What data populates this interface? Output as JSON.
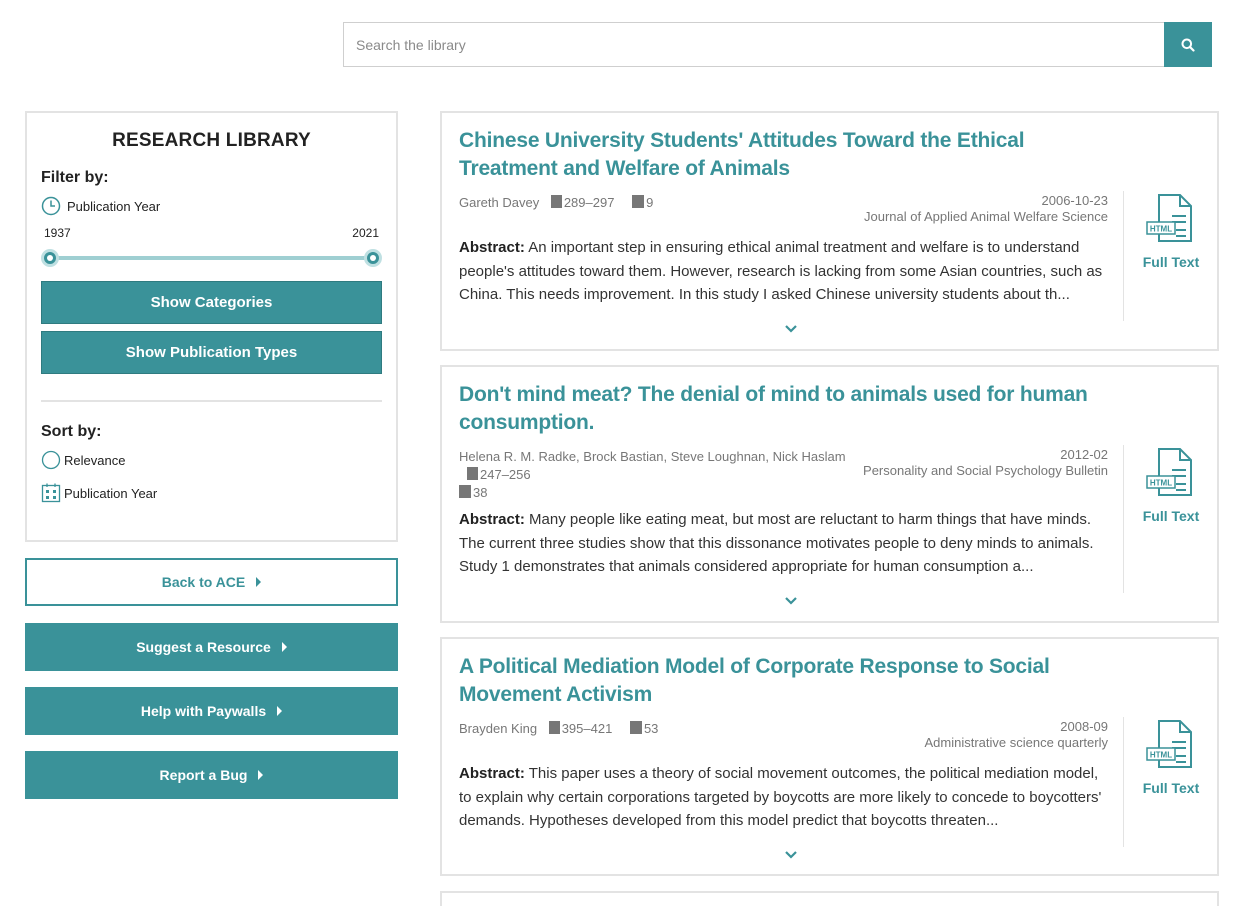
{
  "search": {
    "placeholder": "Search the library",
    "value": ""
  },
  "sidebar": {
    "title": "RESEARCH LIBRARY",
    "filter_label": "Filter by:",
    "filter_publication_year": "Publication Year",
    "year_min": "1937",
    "year_max": "2021",
    "range_low_fraction": 0.0,
    "range_high_fraction": 1.0,
    "show_categories": "Show Categories",
    "show_publication_types": "Show Publication Types",
    "sort_label": "Sort by:",
    "sort_relevance": "Relevance",
    "sort_publication_year": "Publication Year"
  },
  "actions": {
    "back": "Back to ACE",
    "suggest": "Suggest a Resource",
    "paywalls": "Help with Paywalls",
    "bug": "Report a Bug"
  },
  "results": [
    {
      "title": "Chinese University Students' Attitudes Toward the Ethical Treatment and Welfare of Animals",
      "authors": "Gareth Davey",
      "pages": "289–297",
      "volume": "9",
      "date": "2006-10-23",
      "journal": "Journal of Applied Animal Welfare Science",
      "abstract_label": "Abstract:",
      "abstract": "An important step in ensuring ethical animal treatment and welfare is to understand people's attitudes toward them. However, research is lacking from some Asian countries, such as China. This needs improvement. In this study I asked Chinese university students about th...",
      "fulltext_label": "Full Text",
      "badge": "HTML"
    },
    {
      "title": "Don't mind meat? The denial of mind to animals used for human consumption.",
      "authors": "Helena R. M. Radke, Brock Bastian, Steve Loughnan, Nick Haslam",
      "pages": "247–256",
      "volume": "38",
      "date": "2012-02",
      "journal": "Personality and Social Psychology Bulletin",
      "abstract_label": "Abstract:",
      "abstract": "Many people like eating meat, but most are reluctant to harm things that have minds. The current three studies show that this dissonance motivates people to deny minds to animals. Study 1 demonstrates that animals considered appropriate for human consumption a...",
      "fulltext_label": "Full Text",
      "badge": "HTML"
    },
    {
      "title": "A Political Mediation Model of Corporate Response to Social Movement Activism",
      "authors": "Brayden King",
      "pages": "395–421",
      "volume": "53",
      "date": "2008-09",
      "journal": "Administrative science quarterly",
      "abstract_label": "Abstract:",
      "abstract": "This paper uses a theory of social movement outcomes, the political mediation model, to explain why certain corporations targeted by boycotts are more likely to concede to boycotters' demands. Hypotheses developed from this model predict that boycotts threaten...",
      "fulltext_label": "Full Text",
      "badge": "HTML"
    }
  ],
  "colors": {
    "accent": "#3a9299",
    "border": "#e3e3e3",
    "muted": "#777777"
  },
  "icons": {
    "search": "search-icon",
    "filter_year": "clock-icon",
    "sort_relevance": "circle-icon",
    "sort_year": "calendar-icon",
    "pages": "document-icon",
    "volume": "book-icon",
    "fulltext": "html-document-icon",
    "expand": "chevron-down-icon"
  }
}
